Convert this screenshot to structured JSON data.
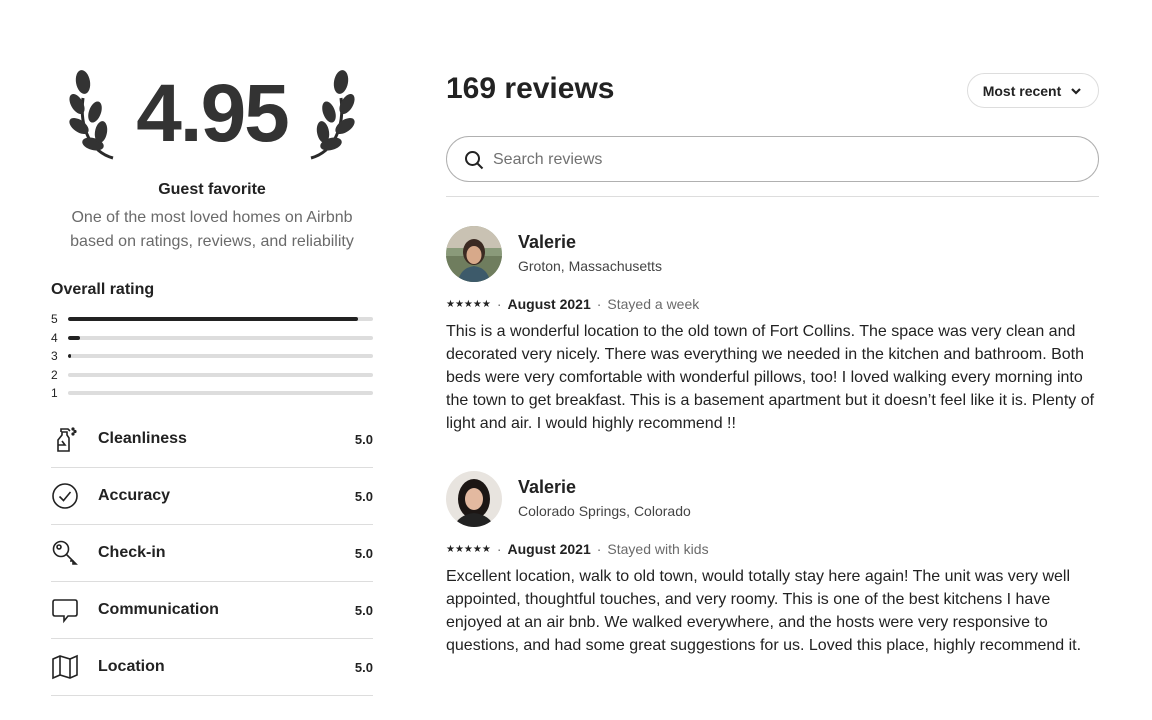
{
  "hero": {
    "score": "4.95",
    "badge_title": "Guest favorite",
    "badge_desc_line1": "One of the most loved homes on Airbnb",
    "badge_desc_line2": "based on ratings, reviews, and reliability"
  },
  "overall": {
    "title": "Overall rating",
    "distribution": [
      {
        "stars": "5",
        "fraction": 0.95
      },
      {
        "stars": "4",
        "fraction": 0.04
      },
      {
        "stars": "3",
        "fraction": 0.01
      },
      {
        "stars": "2",
        "fraction": 0.0
      },
      {
        "stars": "1",
        "fraction": 0.0
      }
    ]
  },
  "categories": [
    {
      "label": "Cleanliness",
      "value": "5.0",
      "icon": "spray-bottle-icon"
    },
    {
      "label": "Accuracy",
      "value": "5.0",
      "icon": "check-circle-icon"
    },
    {
      "label": "Check-in",
      "value": "5.0",
      "icon": "key-icon"
    },
    {
      "label": "Communication",
      "value": "5.0",
      "icon": "chat-bubble-icon"
    },
    {
      "label": "Location",
      "value": "5.0",
      "icon": "map-icon"
    }
  ],
  "reviews_header": {
    "count_title": "169 reviews",
    "sort_label": "Most recent",
    "search_placeholder": "Search reviews"
  },
  "reviews": [
    {
      "name": "Valerie",
      "location": "Groton, Massachusetts",
      "stars": "★★★★★",
      "date": "August 2021",
      "stay": "Stayed a week",
      "text": "This is a wonderful location to the old town of Fort Collins. The space was very clean and decorated very nicely. There was everything we needed in the kitchen and bathroom. Both beds were very comfortable with wonderful pillows, too! I loved walking every morning into the town to get breakfast. This is a basement apartment but it doesn’t feel like it is. Plenty of light and air. I would highly recommend !!"
    },
    {
      "name": "Valerie",
      "location": "Colorado Springs, Colorado",
      "stars": "★★★★★",
      "date": "August 2021",
      "stay": "Stayed with kids",
      "text": "Excellent location, walk to old town, would totally stay here again! The unit was very well appointed, thoughtful touches, and very roomy. This is one of the best kitchens I have enjoyed at an air bnb. We walked everywhere, and the hosts were very responsive to questions, and had some great suggestions for us. Loved this place, highly recommend it."
    }
  ],
  "colors": {
    "text": "#222222",
    "muted": "#6a6a6a",
    "divider": "#dddddd",
    "score": "#333333"
  }
}
